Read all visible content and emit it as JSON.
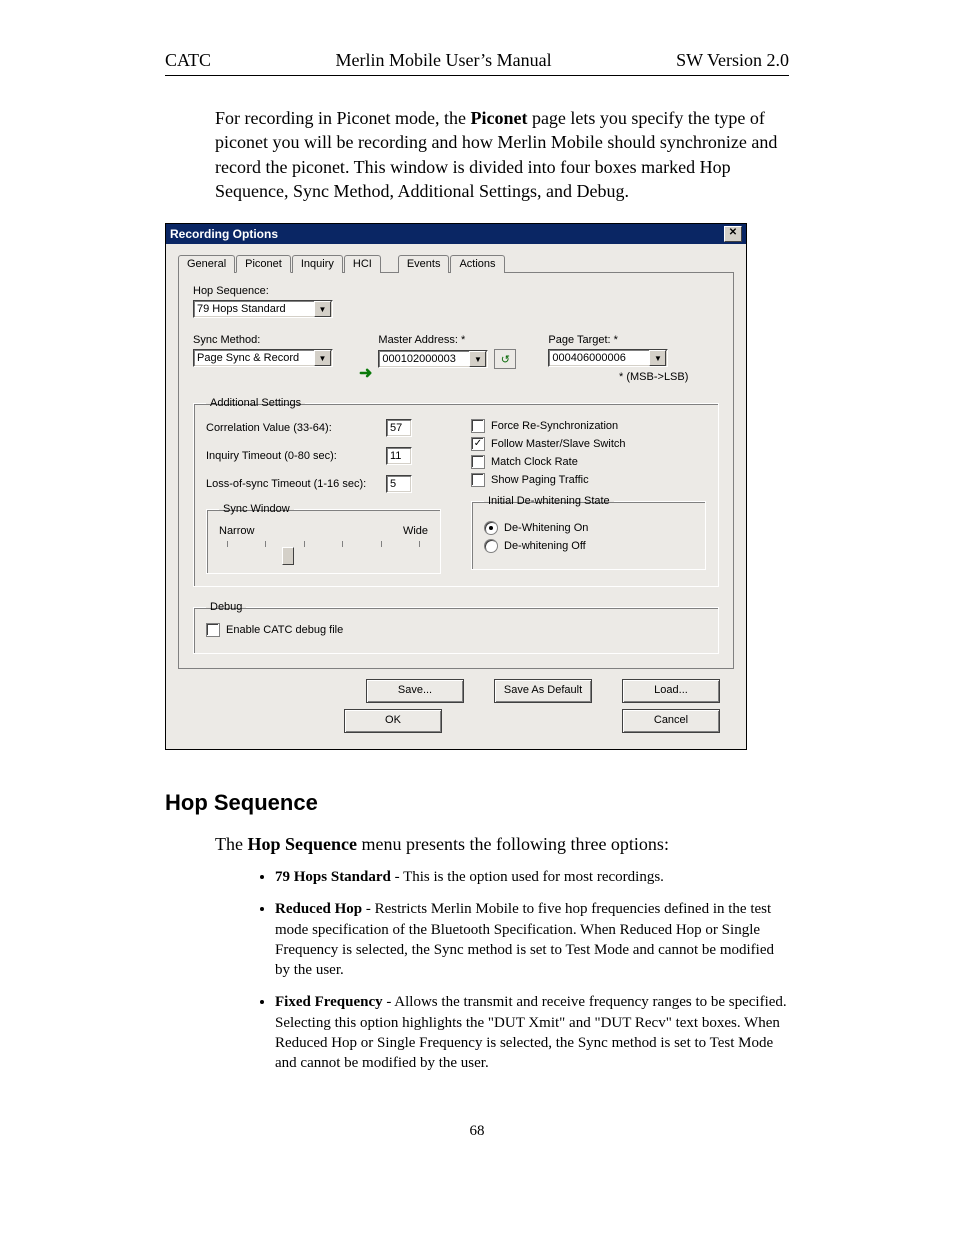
{
  "header": {
    "left": "CATC",
    "center": "Merlin Mobile User’s Manual",
    "right": "SW Version 2.0"
  },
  "intro": {
    "pre": "For recording in Piconet mode, the ",
    "bold": "Piconet",
    "post": " page lets you specify the type of piconet you will be recording and how Merlin Mobile should synchronize and record the piconet.  This window is divided into four boxes marked Hop Sequence, Sync Method,  Additional Settings, and Debug."
  },
  "dialog": {
    "title": "Recording Options",
    "tabs": [
      "General",
      "Piconet",
      "Inquiry",
      "HCI",
      "Events",
      "Actions"
    ],
    "active_tab": "Piconet",
    "hop_sequence": {
      "label": "Hop Sequence:",
      "value": "79 Hops Standard"
    },
    "sync_method": {
      "label": "Sync Method:",
      "value": "Page Sync & Record"
    },
    "master_addr": {
      "label": "Master Address: *",
      "value": "000102000003"
    },
    "page_target": {
      "label": "Page Target: *",
      "value": "000406000006"
    },
    "msb_lsb_note": "* (MSB->LSB)",
    "additional": {
      "legend": "Additional Settings",
      "correlation": {
        "label": "Correlation Value (33-64):",
        "value": "57"
      },
      "inq_timeout": {
        "label": "Inquiry Timeout (0-80 sec):",
        "value": "11"
      },
      "los_timeout": {
        "label": "Loss-of-sync Timeout (1-16 sec):",
        "value": "5"
      },
      "checks": {
        "force_resync": {
          "label": "Force Re-Synchronization",
          "checked": false
        },
        "follow_switch": {
          "label": "Follow Master/Slave Switch",
          "checked": true
        },
        "match_clock": {
          "label": "Match Clock Rate",
          "checked": false
        },
        "show_paging": {
          "label": "Show Paging Traffic",
          "checked": false
        }
      },
      "sync_window": {
        "legend": "Sync Window",
        "narrow": "Narrow",
        "wide": "Wide"
      },
      "dewhitening": {
        "legend": "Initial De-whitening State",
        "on": {
          "label": "De-Whitening On",
          "selected": true
        },
        "off": {
          "label": "De-whitening Off",
          "selected": false
        }
      }
    },
    "debug": {
      "legend": "Debug",
      "enable": {
        "label": "Enable CATC debug file",
        "checked": false
      }
    },
    "buttons": {
      "save": "Save...",
      "save_default": "Save As Default",
      "load": "Load...",
      "ok": "OK",
      "cancel": "Cancel"
    }
  },
  "section": {
    "title": "Hop Sequence",
    "lead_pre": "The ",
    "lead_bold": "Hop Sequence",
    "lead_post": "  menu presents the following three options:",
    "items": [
      {
        "bold": "79 Hops Standard",
        "text": "  - This is the option used for most recordings."
      },
      {
        "bold": "Reduced Hop",
        "text": " - Restricts Merlin Mobile to five hop frequencies defined in the test mode specification of the Bluetooth Specification. When Reduced Hop or Single Frequency is selected, the Sync method is set to Test Mode and cannot be modified by the user."
      },
      {
        "bold": "Fixed Frequency",
        "text": " - Allows the transmit and receive frequency ranges to be specified.  Selecting this option highlights the \"DUT Xmit\" and \"DUT Recv\" text boxes.  When Reduced Hop or Single Frequency is selected, the Sync method is set to Test Mode and cannot be modified by the user."
      }
    ]
  },
  "page_number": "68"
}
